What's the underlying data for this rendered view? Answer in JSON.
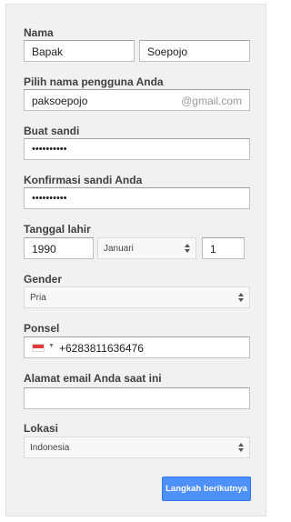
{
  "form": {
    "name": {
      "label": "Nama",
      "first": "Bapak",
      "last": "Soepojo"
    },
    "username": {
      "label": "Pilih nama pengguna Anda",
      "value": "paksoepojo",
      "suffix": "@gmail.com"
    },
    "password": {
      "label": "Buat sandi",
      "value": "••••••••••"
    },
    "confirm_password": {
      "label": "Konfirmasi sandi Anda",
      "value": "••••••••••"
    },
    "birthdate": {
      "label": "Tanggal lahir",
      "year": "1990",
      "month": "Januari",
      "day": "1"
    },
    "gender": {
      "label": "Gender",
      "value": "Pria"
    },
    "phone": {
      "label": "Ponsel",
      "flag_icon": "indonesia-flag-icon",
      "value": "+6283811636476"
    },
    "current_email": {
      "label": "Alamat email Anda saat ini",
      "value": ""
    },
    "location": {
      "label": "Lokasi",
      "value": "Indonesia"
    },
    "next_button": "Langkah berikutnya"
  },
  "colors": {
    "panel_bg": "#f1f1f1",
    "button_bg": "#4d90fe",
    "flag_red": "#e23b3b"
  }
}
